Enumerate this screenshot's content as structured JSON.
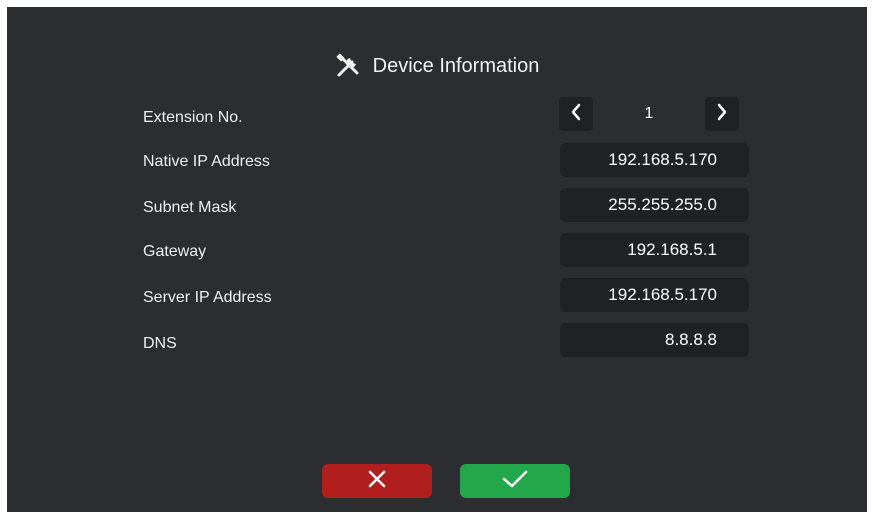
{
  "header": {
    "title": "Device Information",
    "icon": "tools-icon"
  },
  "stepper": {
    "label": "Extension No.",
    "value": "1",
    "prev_icon": "chevron-left-icon",
    "next_icon": "chevron-right-icon"
  },
  "fields": [
    {
      "label": "Native IP Address",
      "value": "192.168.5.170"
    },
    {
      "label": "Subnet Mask",
      "value": "255.255.255.0"
    },
    {
      "label": "Gateway",
      "value": "192.168.5.1"
    },
    {
      "label": "Server IP Address",
      "value": "192.168.5.170"
    },
    {
      "label": "DNS",
      "value": "8.8.8.8"
    }
  ],
  "actions": {
    "cancel_icon": "close-icon",
    "confirm_icon": "check-icon",
    "cancel_color": "#b01e1e",
    "confirm_color": "#22a84a"
  },
  "colors": {
    "background": "#2b2d31",
    "field_background": "#1f2125",
    "text": "#f0f0f0"
  }
}
